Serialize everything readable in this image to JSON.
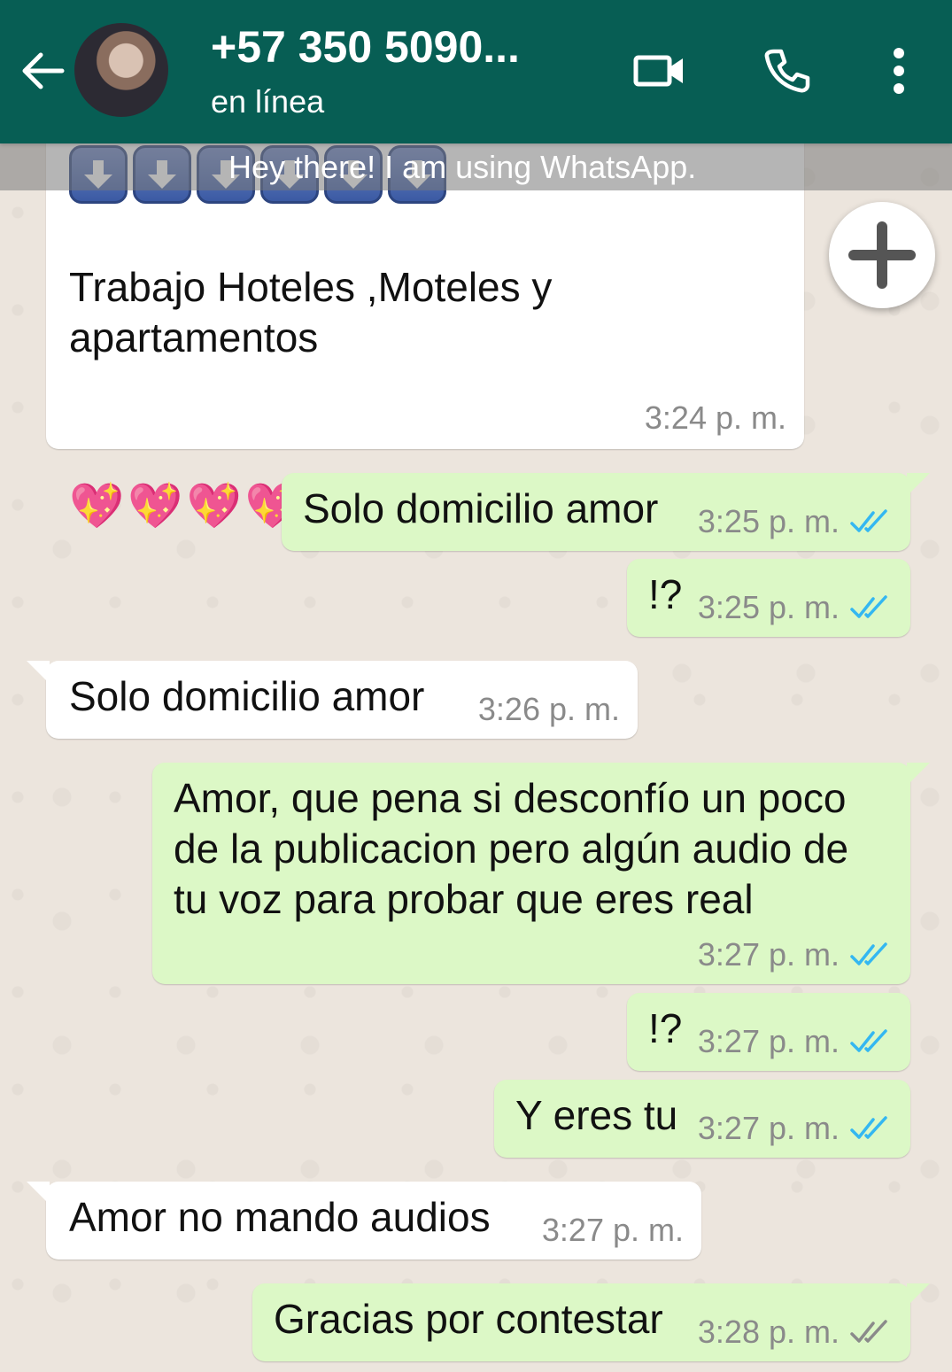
{
  "header": {
    "contact_name": "+57 350 5090...",
    "status": "en línea",
    "icons": [
      "back-arrow-icon",
      "video-call-icon",
      "phone-icon",
      "more-options-icon"
    ]
  },
  "status_overlay": "Hey there! I am using WhatsApp.",
  "colors": {
    "header": "#075e54",
    "outgoing": "#dcf8c6",
    "incoming": "#ffffff",
    "read_ticks": "#34b7f1",
    "background": "#ece5dd"
  },
  "messages": [
    {
      "dir": "in",
      "text": "Trabajo Hoteles ,Moteles y\napartamentos",
      "hearts": "💖💖💖💖💖💖💖",
      "time": "3:24 p. m."
    },
    {
      "dir": "out",
      "text": "Solo domicilio amor",
      "time": "3:25 p. m.",
      "ticks": "read"
    },
    {
      "dir": "out",
      "text": "!?",
      "time": "3:25 p. m.",
      "ticks": "read"
    },
    {
      "dir": "in",
      "text": "Solo domicilio amor",
      "time": "3:26 p. m."
    },
    {
      "dir": "out",
      "text": "Amor, que pena si desconfío un poco\nde la publicacion pero algún audio de\ntu voz para probar que eres real",
      "time": "3:27 p. m.",
      "ticks": "read"
    },
    {
      "dir": "out",
      "text": "!?",
      "time": "3:27 p. m.",
      "ticks": "read"
    },
    {
      "dir": "out",
      "text": "Y eres tu",
      "time": "3:27 p. m.",
      "ticks": "read"
    },
    {
      "dir": "in",
      "text": "Amor no mando audios",
      "time": "3:27 p. m."
    },
    {
      "dir": "out",
      "text": "Gracias por contestar",
      "time": "3:28 p. m.",
      "ticks": "delivered"
    }
  ]
}
